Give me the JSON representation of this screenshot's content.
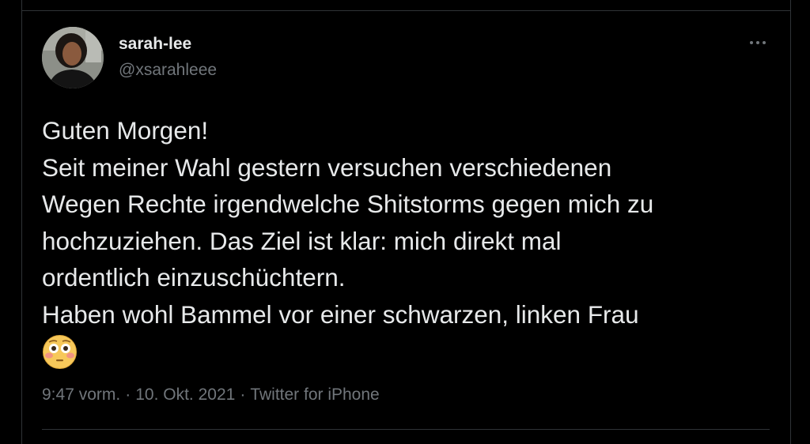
{
  "tweet": {
    "author": {
      "display_name": "sarah-lee",
      "handle": "@xsarahleee"
    },
    "text_lines": [
      "Guten Morgen!",
      "Seit meiner Wahl gestern versuchen verschiedenen",
      "Wegen Rechte irgendwelche Shitstorms gegen mich zu",
      "hochzuziehen. Das Ziel ist klar: mich direkt mal",
      "ordentlich einzuschüchtern.",
      "Haben wohl Bammel vor einer schwarzen, linken Frau"
    ],
    "emoji": "flushed-face-icon",
    "meta": {
      "time": "9:47 vorm.",
      "separator": "·",
      "date": "10. Okt. 2021",
      "source": "Twitter for iPhone"
    }
  },
  "colors": {
    "background": "#000000",
    "primary_text": "#e7e9ea",
    "secondary_text": "#71767b",
    "divider": "#2f3336"
  },
  "icons": {
    "more": "more-horizontal-icon",
    "avatar": "avatar"
  }
}
